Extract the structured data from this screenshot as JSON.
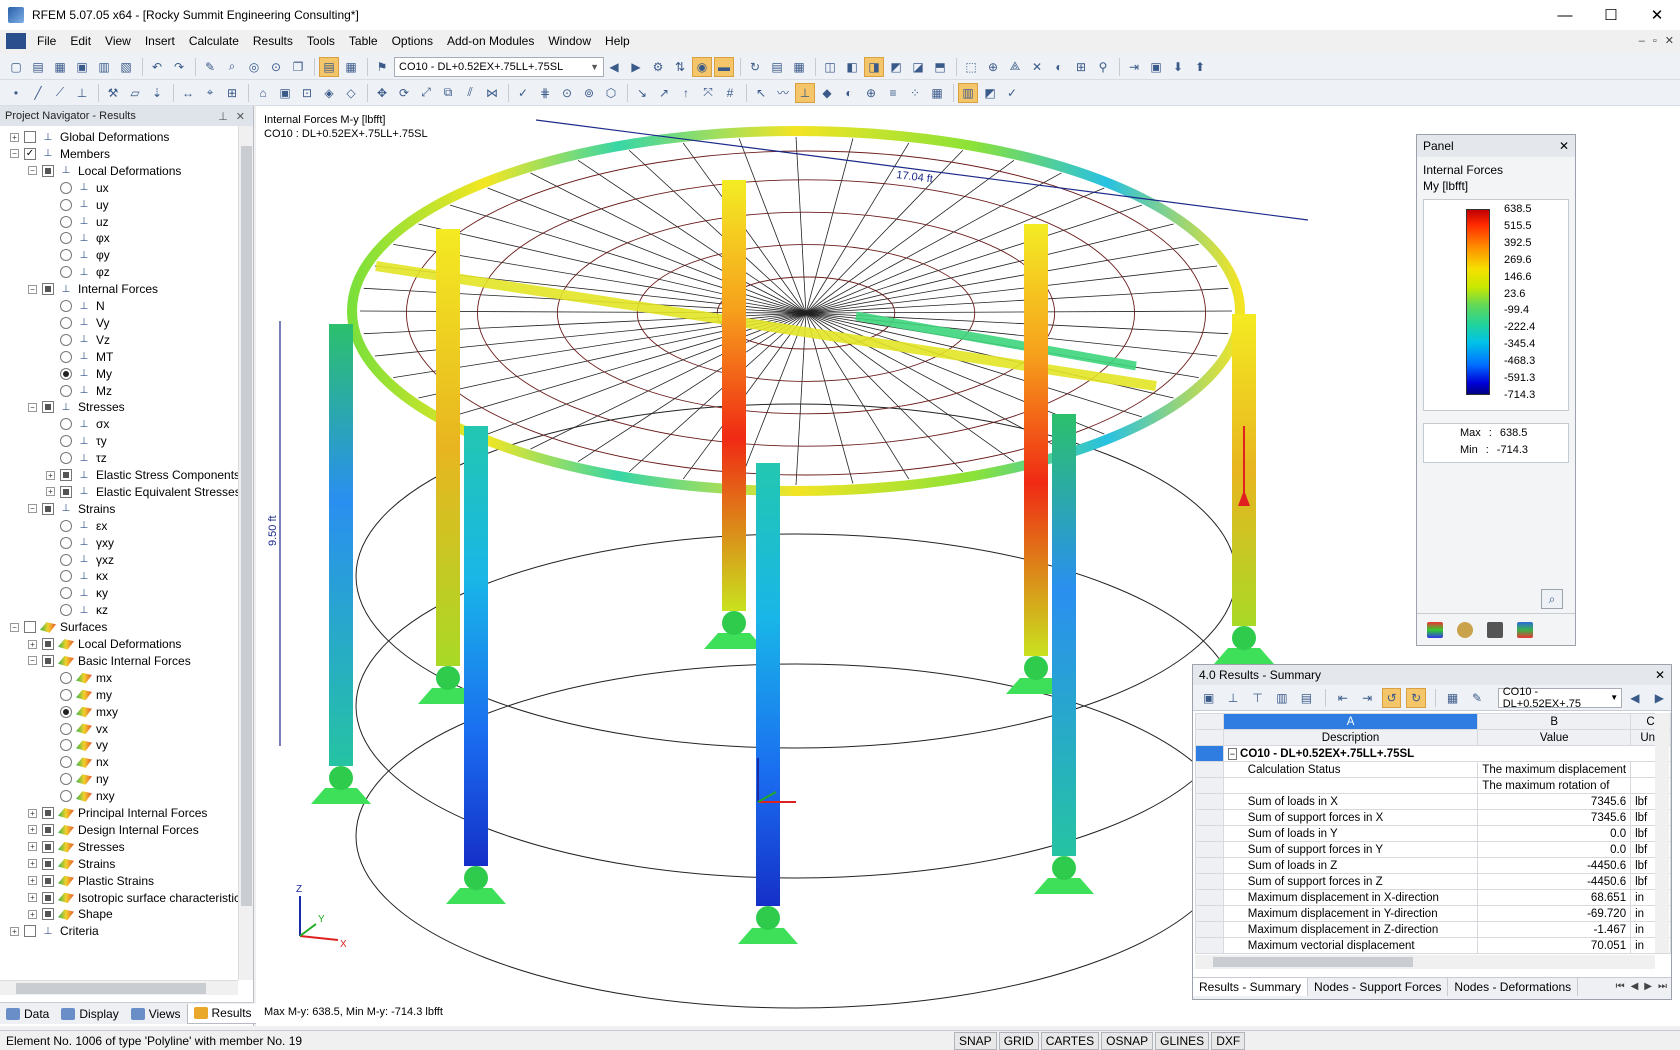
{
  "window": {
    "title": "RFEM 5.07.05 x64 - [Rocky Summit Engineering Consulting*]",
    "minimize_glyph": "—",
    "maximize_glyph": "☐",
    "close_glyph": "✕"
  },
  "menu": {
    "items": [
      "File",
      "Edit",
      "View",
      "Insert",
      "Calculate",
      "Results",
      "Tools",
      "Table",
      "Options",
      "Add-on Modules",
      "Window",
      "Help"
    ],
    "mdi_controls": [
      "–",
      "▫",
      "✕"
    ]
  },
  "toolbar": {
    "load_combo": "CO10 - DL+0.52EX+.75LL+.75SL"
  },
  "navigator": {
    "title": "Project Navigator - Results",
    "pin_glyph": "⊥",
    "close_glyph": "✕",
    "rows": [
      {
        "label": "Global Deformations",
        "level": 0,
        "exp": "+",
        "chk": "none"
      },
      {
        "label": "Members",
        "level": 0,
        "exp": "−",
        "chk": "checked"
      },
      {
        "label": "Local Deformations",
        "level": 1,
        "exp": "−",
        "chk": "part"
      },
      {
        "label": "ux",
        "level": 2,
        "radio": false
      },
      {
        "label": "uy",
        "level": 2,
        "radio": false
      },
      {
        "label": "uz",
        "level": 2,
        "radio": false
      },
      {
        "label": "φx",
        "level": 2,
        "radio": false
      },
      {
        "label": "φy",
        "level": 2,
        "radio": false
      },
      {
        "label": "φz",
        "level": 2,
        "radio": false
      },
      {
        "label": "Internal Forces",
        "level": 1,
        "exp": "−",
        "chk": "part"
      },
      {
        "label": "N",
        "level": 2,
        "radio": false
      },
      {
        "label": "Vy",
        "level": 2,
        "radio": false
      },
      {
        "label": "Vz",
        "level": 2,
        "radio": false
      },
      {
        "label": "MT",
        "level": 2,
        "radio": false
      },
      {
        "label": "My",
        "level": 2,
        "radio": true
      },
      {
        "label": "Mz",
        "level": 2,
        "radio": false
      },
      {
        "label": "Stresses",
        "level": 1,
        "exp": "−",
        "chk": "part"
      },
      {
        "label": "σx",
        "level": 2,
        "radio": false
      },
      {
        "label": "τy",
        "level": 2,
        "radio": false
      },
      {
        "label": "τz",
        "level": 2,
        "radio": false
      },
      {
        "label": "Elastic Stress Components",
        "level": 2,
        "exp": "+",
        "chk": "part"
      },
      {
        "label": "Elastic Equivalent Stresses",
        "level": 2,
        "exp": "+",
        "chk": "part"
      },
      {
        "label": "Strains",
        "level": 1,
        "exp": "−",
        "chk": "part"
      },
      {
        "label": "εx",
        "level": 2,
        "radio": false
      },
      {
        "label": "γxy",
        "level": 2,
        "radio": false
      },
      {
        "label": "γxz",
        "level": 2,
        "radio": false
      },
      {
        "label": "κx",
        "level": 2,
        "radio": false
      },
      {
        "label": "κy",
        "level": 2,
        "radio": false
      },
      {
        "label": "κz",
        "level": 2,
        "radio": false
      },
      {
        "label": "Surfaces",
        "level": 0,
        "exp": "−",
        "chk": "none",
        "surf": true
      },
      {
        "label": "Local Deformations",
        "level": 1,
        "exp": "+",
        "chk": "part",
        "surf": true
      },
      {
        "label": "Basic Internal Forces",
        "level": 1,
        "exp": "−",
        "chk": "part",
        "surf": true
      },
      {
        "label": "mx",
        "level": 2,
        "radio": false,
        "surf": true
      },
      {
        "label": "my",
        "level": 2,
        "radio": false,
        "surf": true
      },
      {
        "label": "mxy",
        "level": 2,
        "radio": true,
        "surf": true
      },
      {
        "label": "vx",
        "level": 2,
        "radio": false,
        "surf": true
      },
      {
        "label": "vy",
        "level": 2,
        "radio": false,
        "surf": true
      },
      {
        "label": "nx",
        "level": 2,
        "radio": false,
        "surf": true
      },
      {
        "label": "ny",
        "level": 2,
        "radio": false,
        "surf": true
      },
      {
        "label": "nxy",
        "level": 2,
        "radio": false,
        "surf": true
      },
      {
        "label": "Principal Internal Forces",
        "level": 1,
        "exp": "+",
        "chk": "part",
        "surf": true
      },
      {
        "label": "Design Internal Forces",
        "level": 1,
        "exp": "+",
        "chk": "part",
        "surf": true
      },
      {
        "label": "Stresses",
        "level": 1,
        "exp": "+",
        "chk": "part",
        "surf": true
      },
      {
        "label": "Strains",
        "level": 1,
        "exp": "+",
        "chk": "part",
        "surf": true
      },
      {
        "label": "Plastic Strains",
        "level": 1,
        "exp": "+",
        "chk": "part",
        "surf": true
      },
      {
        "label": "Isotropic surface characteristics",
        "level": 1,
        "exp": "+",
        "chk": "part",
        "surf": true
      },
      {
        "label": "Shape",
        "level": 1,
        "exp": "+",
        "chk": "part",
        "surf": true
      },
      {
        "label": "Criteria",
        "level": 0,
        "exp": "+",
        "chk": "none"
      }
    ],
    "tabs": [
      "Data",
      "Display",
      "Views",
      "Results"
    ],
    "active_tab": "Results"
  },
  "viewport": {
    "result_title": "Internal Forces M-y [lbfft]",
    "load_case": "CO10 : DL+0.52EX+.75LL+.75SL",
    "dimension_width": "17.04 ft",
    "dimension_height": "9.50 ft",
    "footer": "Max M-y: 638.5, Min M-y: -714.3 lbfft",
    "axis_labels": {
      "x": "X",
      "y": "Y",
      "z": "Z"
    }
  },
  "panel": {
    "title": "Panel",
    "close_glyph": "✕",
    "heading": "Internal Forces",
    "unit": "My [lbfft]",
    "legend_values": [
      "638.5",
      "515.5",
      "392.5",
      "269.6",
      "146.6",
      "23.6",
      "-99.4",
      "-222.4",
      "-345.4",
      "-468.3",
      "-591.3",
      "-714.3"
    ],
    "max_label": "Max",
    "max_value": "638.5",
    "min_label": "Min",
    "min_value": "-714.3",
    "colon": ":"
  },
  "results": {
    "title": "4.0 Results - Summary",
    "close_glyph": "✕",
    "combo": "CO10 - DL+0.52EX+.75",
    "col_letters": [
      "A",
      "B",
      "C"
    ],
    "col_headers": [
      "Description",
      "Value",
      "Unit"
    ],
    "group": "CO10 - DL+0.52EX+.75LL+.75SL",
    "rows": [
      {
        "desc": "Calculation Status",
        "value": "The maximum displacement",
        "unit": ""
      },
      {
        "desc": "",
        "value": "The maximum rotation of",
        "unit": ""
      },
      {
        "desc": "Sum of loads in X",
        "value": "7345.6",
        "unit": "lbf"
      },
      {
        "desc": "Sum of support forces in X",
        "value": "7345.6",
        "unit": "lbf"
      },
      {
        "desc": "Sum of loads in Y",
        "value": "0.0",
        "unit": "lbf"
      },
      {
        "desc": "Sum of support forces in Y",
        "value": "0.0",
        "unit": "lbf"
      },
      {
        "desc": "Sum of loads in Z",
        "value": "-4450.6",
        "unit": "lbf"
      },
      {
        "desc": "Sum of support forces in Z",
        "value": "-4450.6",
        "unit": "lbf"
      },
      {
        "desc": "Maximum displacement in X-direction",
        "value": "68.651",
        "unit": "in"
      },
      {
        "desc": "Maximum displacement in Y-direction",
        "value": "-69.720",
        "unit": "in"
      },
      {
        "desc": "Maximum displacement in Z-direction",
        "value": "-1.467",
        "unit": "in"
      },
      {
        "desc": "Maximum vectorial displacement",
        "value": "70.051",
        "unit": "in"
      }
    ],
    "tabs": [
      "Results - Summary",
      "Nodes - Support Forces",
      "Nodes - Deformations"
    ],
    "active_tab": "Results - Summary"
  },
  "statusbar": {
    "text": "Element No. 1006 of type 'Polyline' with member No. 19",
    "toggles": [
      "SNAP",
      "GRID",
      "CARTES",
      "OSNAP",
      "GLINES",
      "DXF"
    ]
  }
}
